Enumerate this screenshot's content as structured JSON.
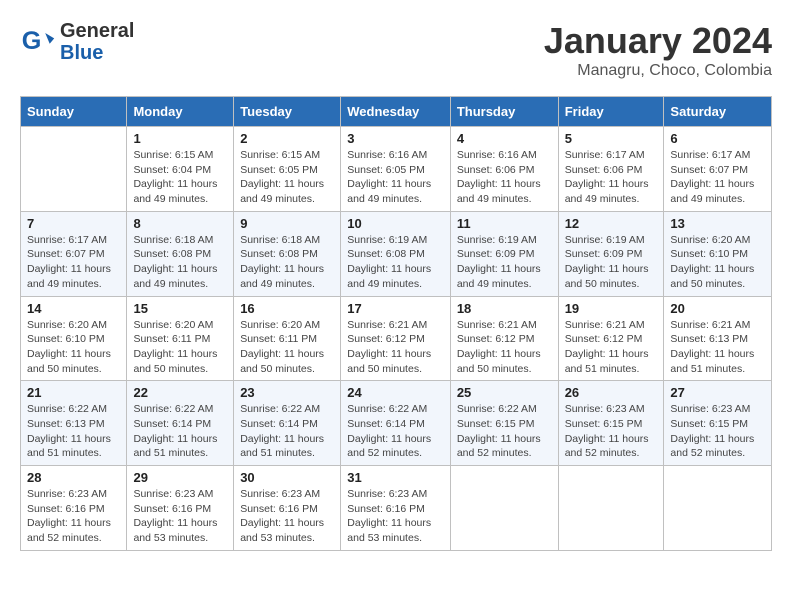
{
  "header": {
    "logo_general": "General",
    "logo_blue": "Blue",
    "month_title": "January 2024",
    "subtitle": "Managru, Choco, Colombia"
  },
  "days_of_week": [
    "Sunday",
    "Monday",
    "Tuesday",
    "Wednesday",
    "Thursday",
    "Friday",
    "Saturday"
  ],
  "weeks": [
    [
      {
        "day": "",
        "detail": ""
      },
      {
        "day": "1",
        "detail": "Sunrise: 6:15 AM\nSunset: 6:04 PM\nDaylight: 11 hours\nand 49 minutes."
      },
      {
        "day": "2",
        "detail": "Sunrise: 6:15 AM\nSunset: 6:05 PM\nDaylight: 11 hours\nand 49 minutes."
      },
      {
        "day": "3",
        "detail": "Sunrise: 6:16 AM\nSunset: 6:05 PM\nDaylight: 11 hours\nand 49 minutes."
      },
      {
        "day": "4",
        "detail": "Sunrise: 6:16 AM\nSunset: 6:06 PM\nDaylight: 11 hours\nand 49 minutes."
      },
      {
        "day": "5",
        "detail": "Sunrise: 6:17 AM\nSunset: 6:06 PM\nDaylight: 11 hours\nand 49 minutes."
      },
      {
        "day": "6",
        "detail": "Sunrise: 6:17 AM\nSunset: 6:07 PM\nDaylight: 11 hours\nand 49 minutes."
      }
    ],
    [
      {
        "day": "7",
        "detail": "Sunrise: 6:17 AM\nSunset: 6:07 PM\nDaylight: 11 hours\nand 49 minutes."
      },
      {
        "day": "8",
        "detail": "Sunrise: 6:18 AM\nSunset: 6:08 PM\nDaylight: 11 hours\nand 49 minutes."
      },
      {
        "day": "9",
        "detail": "Sunrise: 6:18 AM\nSunset: 6:08 PM\nDaylight: 11 hours\nand 49 minutes."
      },
      {
        "day": "10",
        "detail": "Sunrise: 6:19 AM\nSunset: 6:08 PM\nDaylight: 11 hours\nand 49 minutes."
      },
      {
        "day": "11",
        "detail": "Sunrise: 6:19 AM\nSunset: 6:09 PM\nDaylight: 11 hours\nand 49 minutes."
      },
      {
        "day": "12",
        "detail": "Sunrise: 6:19 AM\nSunset: 6:09 PM\nDaylight: 11 hours\nand 50 minutes."
      },
      {
        "day": "13",
        "detail": "Sunrise: 6:20 AM\nSunset: 6:10 PM\nDaylight: 11 hours\nand 50 minutes."
      }
    ],
    [
      {
        "day": "14",
        "detail": "Sunrise: 6:20 AM\nSunset: 6:10 PM\nDaylight: 11 hours\nand 50 minutes."
      },
      {
        "day": "15",
        "detail": "Sunrise: 6:20 AM\nSunset: 6:11 PM\nDaylight: 11 hours\nand 50 minutes."
      },
      {
        "day": "16",
        "detail": "Sunrise: 6:20 AM\nSunset: 6:11 PM\nDaylight: 11 hours\nand 50 minutes."
      },
      {
        "day": "17",
        "detail": "Sunrise: 6:21 AM\nSunset: 6:12 PM\nDaylight: 11 hours\nand 50 minutes."
      },
      {
        "day": "18",
        "detail": "Sunrise: 6:21 AM\nSunset: 6:12 PM\nDaylight: 11 hours\nand 50 minutes."
      },
      {
        "day": "19",
        "detail": "Sunrise: 6:21 AM\nSunset: 6:12 PM\nDaylight: 11 hours\nand 51 minutes."
      },
      {
        "day": "20",
        "detail": "Sunrise: 6:21 AM\nSunset: 6:13 PM\nDaylight: 11 hours\nand 51 minutes."
      }
    ],
    [
      {
        "day": "21",
        "detail": "Sunrise: 6:22 AM\nSunset: 6:13 PM\nDaylight: 11 hours\nand 51 minutes."
      },
      {
        "day": "22",
        "detail": "Sunrise: 6:22 AM\nSunset: 6:14 PM\nDaylight: 11 hours\nand 51 minutes."
      },
      {
        "day": "23",
        "detail": "Sunrise: 6:22 AM\nSunset: 6:14 PM\nDaylight: 11 hours\nand 51 minutes."
      },
      {
        "day": "24",
        "detail": "Sunrise: 6:22 AM\nSunset: 6:14 PM\nDaylight: 11 hours\nand 52 minutes."
      },
      {
        "day": "25",
        "detail": "Sunrise: 6:22 AM\nSunset: 6:15 PM\nDaylight: 11 hours\nand 52 minutes."
      },
      {
        "day": "26",
        "detail": "Sunrise: 6:23 AM\nSunset: 6:15 PM\nDaylight: 11 hours\nand 52 minutes."
      },
      {
        "day": "27",
        "detail": "Sunrise: 6:23 AM\nSunset: 6:15 PM\nDaylight: 11 hours\nand 52 minutes."
      }
    ],
    [
      {
        "day": "28",
        "detail": "Sunrise: 6:23 AM\nSunset: 6:16 PM\nDaylight: 11 hours\nand 52 minutes."
      },
      {
        "day": "29",
        "detail": "Sunrise: 6:23 AM\nSunset: 6:16 PM\nDaylight: 11 hours\nand 53 minutes."
      },
      {
        "day": "30",
        "detail": "Sunrise: 6:23 AM\nSunset: 6:16 PM\nDaylight: 11 hours\nand 53 minutes."
      },
      {
        "day": "31",
        "detail": "Sunrise: 6:23 AM\nSunset: 6:16 PM\nDaylight: 11 hours\nand 53 minutes."
      },
      {
        "day": "",
        "detail": ""
      },
      {
        "day": "",
        "detail": ""
      },
      {
        "day": "",
        "detail": ""
      }
    ]
  ]
}
